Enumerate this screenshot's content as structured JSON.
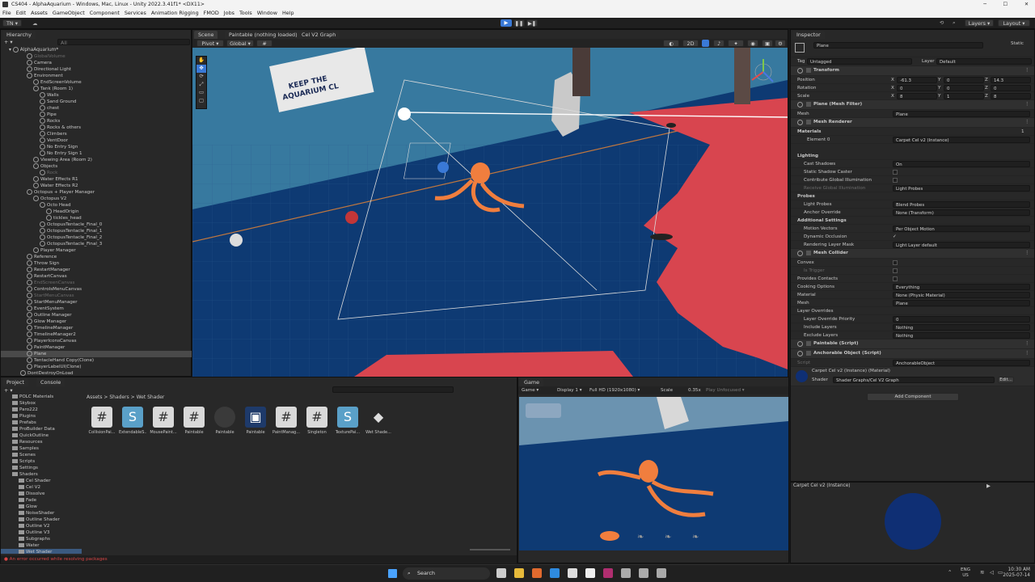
{
  "window": {
    "title": "CS404 - AlphaAquarium - Windows, Mac, Linux - Unity 2022.3.41f1* <DX11>"
  },
  "menu": [
    "File",
    "Edit",
    "Assets",
    "GameObject",
    "Component",
    "Services",
    "Animation Rigging",
    "FMOD",
    "Jobs",
    "Tools",
    "Window",
    "Help"
  ],
  "toolbar": {
    "account": "TN",
    "layers": "Layers",
    "layout": "Layout"
  },
  "hierarchy": {
    "tab": "Hierarchy",
    "search_placeholder": "All",
    "scene": "AlphaAquarium*",
    "items": [
      "GlobalVolume",
      "Camera",
      "Directional Light",
      "Environment",
      "EndScreenVolume",
      "Tank (Room 1)",
      "Walls",
      "Sand Ground",
      "chest",
      "Pipe",
      "Rocks",
      "Rocks & others",
      "Climbers",
      "VentDoor",
      "No Entry Sign",
      "No Entry Sign 1",
      "Viewing Area (Room 2)",
      "Objects",
      "Rock",
      "Water Effects R1",
      "Water Effects R2",
      "Octopus + Player Manager",
      "Octopus V2",
      "Octo Head",
      "HeadOrigin",
      "tickles_head",
      "OctopusTentacle_Final_0",
      "OctopusTentacle_Final_1",
      "OctopusTentacle_Final_2",
      "OctopusTentacle_Final_3",
      "Player Manager",
      "Reference",
      "Throw Sign",
      "RestartManager",
      "RestartCanvas",
      "EndScreenCanvas",
      "ControlsMenuCanvas",
      "StartMenuCanvas",
      "StartMenuManager",
      "EventSystem",
      "Outline Manager",
      "Glow Manager",
      "TimelineManager",
      "TimelineManager2",
      "PlayerIconsCanvas",
      "PaintManager",
      "Plane",
      "TentacleHand Copy(Clone)",
      "PlayerLabelUI(Clone)",
      "DontDestroyOnLoad"
    ]
  },
  "scene": {
    "tabs": [
      "Scene",
      "Paintable (nothing loaded)",
      "Cel V2 Graph"
    ],
    "pivot": "Pivot",
    "global": "Global",
    "sign_line1": "KEEP THE",
    "sign_line2": "AQUARIUM CL"
  },
  "project": {
    "tabs": [
      "Project",
      "Console"
    ],
    "folders": [
      "POLC Materials",
      "Skybox",
      "Paro222",
      "Plugins",
      "Prefabs",
      "ProBuilder Data",
      "QuickOutline",
      "Resources",
      "Samples",
      "Scenes",
      "Scripts",
      "Settings",
      "Shaders",
      "Cel Shader",
      "Cel V2",
      "Dissolve",
      "Fade",
      "Glow",
      "NoiseShader",
      "Outline Shader",
      "Outline V2",
      "Outline V3",
      "Subgraphs",
      "Water",
      "Wet Shader"
    ],
    "breadcrumb": "Assets > Shaders > Wet Shader",
    "assets": [
      {
        "name": "CollisionPai...",
        "icon": "#"
      },
      {
        "name": "ExtendableS...",
        "icon": "S"
      },
      {
        "name": "MousePaint...",
        "icon": "#"
      },
      {
        "name": "Paintable",
        "icon": "#"
      },
      {
        "name": "Paintable",
        "icon": "sphere"
      },
      {
        "name": "Paintable",
        "icon": "graph"
      },
      {
        "name": "PaintManag...",
        "icon": "#"
      },
      {
        "name": "Singleton",
        "icon": "#"
      },
      {
        "name": "TexturePai...",
        "icon": "S"
      },
      {
        "name": "Wet Shade...",
        "icon": "unity"
      }
    ],
    "error": "An error occurred while resolving packages"
  },
  "game": {
    "tab": "Game",
    "display": "Game",
    "display_num": "Display 1",
    "resolution": "Full HD (1920x1080)",
    "scale_label": "Scale",
    "scale": "0.35x",
    "play": "Play Unfocused"
  },
  "inspector": {
    "tab": "Inspector",
    "static": "Static",
    "object": "Plane",
    "tag_label": "Tag",
    "tag": "Untagged",
    "layer_label": "Layer",
    "layer": "Default",
    "transform": {
      "title": "Transform",
      "rows": [
        {
          "label": "Position",
          "x": "-61.3",
          "y": "0",
          "z": "14.3"
        },
        {
          "label": "Rotation",
          "x": "0",
          "y": "0",
          "z": "0"
        },
        {
          "label": "Scale",
          "x": "8",
          "y": "1",
          "z": "8"
        }
      ]
    },
    "mesh_filter": {
      "title": "Plane (Mesh Filter)",
      "mesh_label": "Mesh",
      "mesh": "Plane"
    },
    "mesh_renderer": {
      "title": "Mesh Renderer",
      "materials": "Materials",
      "count": "1",
      "element": "Element 0",
      "element_val": "Carpet Cel v2 (Instance)",
      "lighting": "Lighting",
      "cast": "Cast Shadows",
      "cast_val": "On",
      "static_caster": "Static Shadow Caster",
      "contrib": "Contribute Global Illumination",
      "receive": "Receive Global Illumination",
      "receive_val": "Light Probes",
      "probes": "Probes",
      "light_probes": "Light Probes",
      "light_probes_val": "Blend Probes",
      "anchor": "Anchor Override",
      "anchor_val": "None (Transform)",
      "additional": "Additional Settings",
      "motion": "Motion Vectors",
      "motion_val": "Per Object Motion",
      "dynamic": "Dynamic Occlusion",
      "rlm": "Rendering Layer Mask",
      "rlm_val": "Light Layer default"
    },
    "mesh_collider": {
      "title": "Mesh Collider",
      "convex": "Convex",
      "trigger": "Is Trigger",
      "contacts": "Provides Contacts",
      "cooking": "Cooking Options",
      "cooking_val": "Everything",
      "material": "Material",
      "material_val": "None (Physic Material)",
      "mesh": "Mesh",
      "mesh_val": "Plane",
      "overrides": "Layer Overrides",
      "priority": "Layer Override Priority",
      "priority_val": "0",
      "include": "Include Layers",
      "include_val": "Nothing",
      "exclude": "Exclude Layers",
      "exclude_val": "Nothing"
    },
    "paintable": "Paintable (Script)",
    "anchorable": "Anchorable Object (Script)",
    "script_label": "Script",
    "script_val": "AnchorableObject",
    "material_box": {
      "name": "Carpet Cel v2 (Instance) (Material)",
      "shader_label": "Shader",
      "shader": "Shader Graphs/Cel V2 Graph",
      "edit": "Edit..."
    },
    "add_component": "Add Component",
    "preview_title": "Carpet Cel v2 (Instance)"
  },
  "taskbar": {
    "search": "Search",
    "lang1": "ENG",
    "lang2": "US",
    "time": "10:30 AM",
    "date": "2025-07-14"
  },
  "colors": {
    "accent": "#3a79d6",
    "water": "#0e3a73",
    "carpet": "#d8454f",
    "octopus": "#f07e3e"
  }
}
